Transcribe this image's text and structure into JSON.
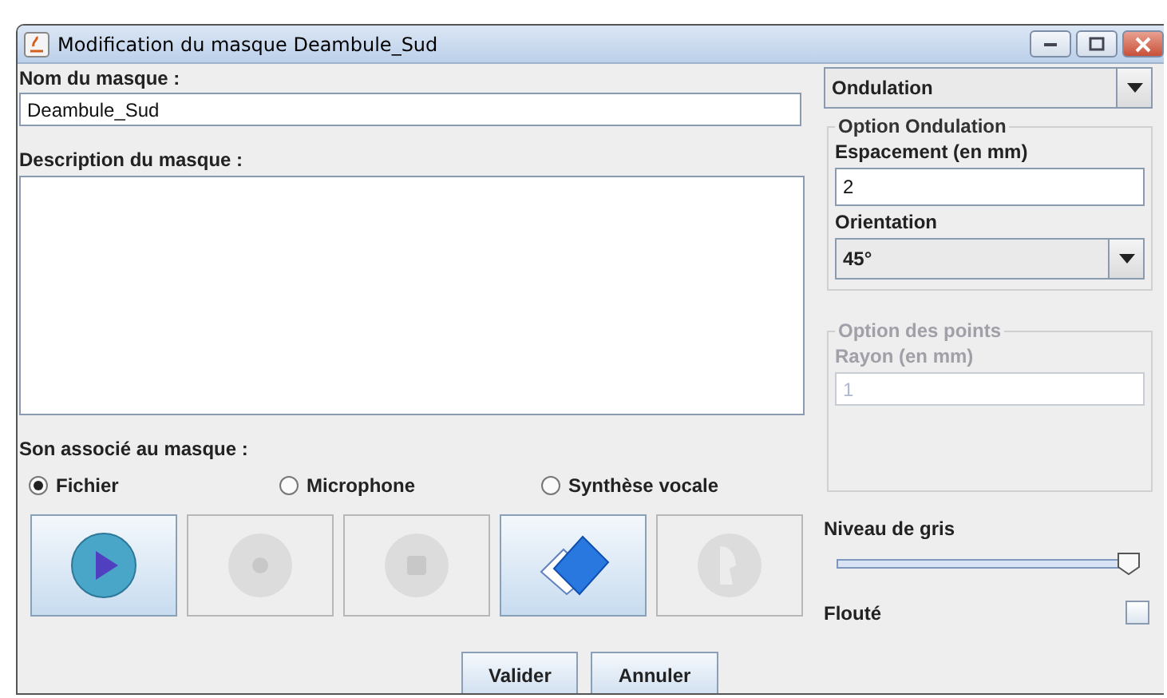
{
  "window": {
    "title": "Modification du masque Deambule_Sud"
  },
  "name_field": {
    "label": "Nom du masque :",
    "value": "Deambule_Sud"
  },
  "description_field": {
    "label": "Description du masque :"
  },
  "sound": {
    "label": "Son associé au masque :",
    "sources": [
      {
        "label": "Fichier",
        "selected": true
      },
      {
        "label": "Microphone",
        "selected": false
      },
      {
        "label": "Synthèse vocale",
        "selected": false
      }
    ],
    "buttons": [
      {
        "kind": "play",
        "disabled": false
      },
      {
        "kind": "record",
        "disabled": true
      },
      {
        "kind": "stop",
        "disabled": true
      },
      {
        "kind": "open",
        "disabled": false
      },
      {
        "kind": "speech",
        "disabled": true
      }
    ]
  },
  "actions": [
    "Valider",
    "Annuler"
  ],
  "mask_type": {
    "value": "Ondulation"
  },
  "wave_options": {
    "title": "Option Ondulation",
    "spacing_label": "Espacement (en mm)",
    "spacing_value": "2",
    "orientation_label": "Orientation",
    "orientation_value": "45°"
  },
  "dot_options": {
    "title": "Option des points",
    "radius_label": "Rayon (en mm)",
    "radius_value": "1",
    "disabled": true
  },
  "gray_level": {
    "label": "Niveau de gris",
    "level": 0.98
  },
  "blur": {
    "label": "Flouté",
    "checked": false
  }
}
